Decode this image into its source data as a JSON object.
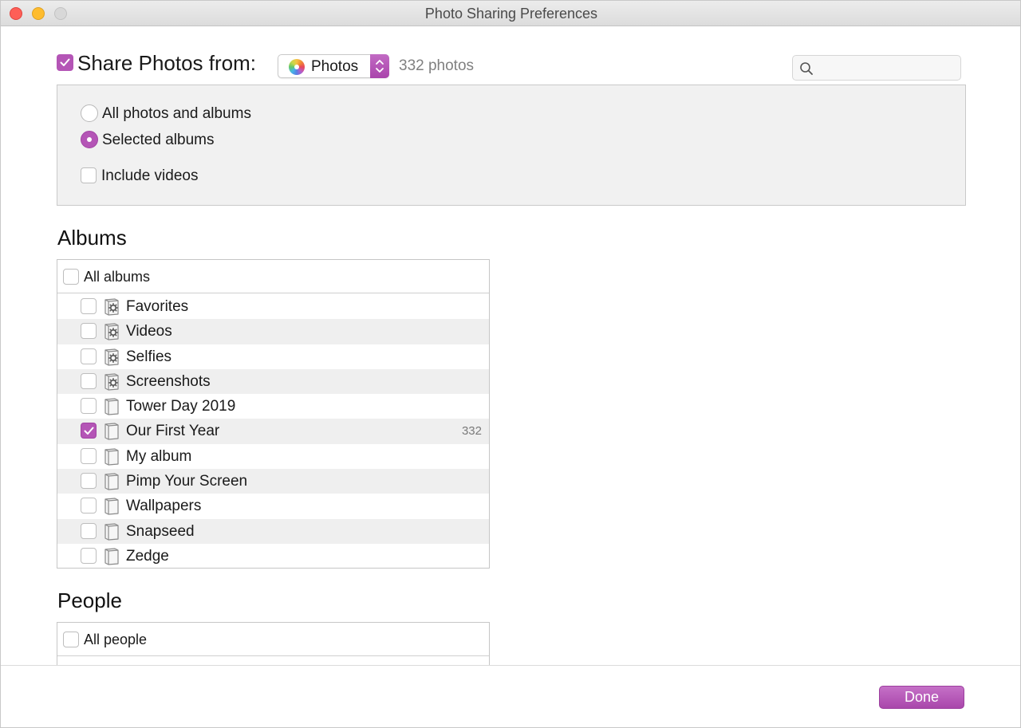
{
  "window": {
    "title": "Photo Sharing Preferences"
  },
  "header": {
    "share_label": "Share Photos from:",
    "share_checked": true,
    "source": {
      "label": "Photos",
      "icon": "photos-app-icon"
    },
    "photo_count": "332 photos",
    "search": {
      "placeholder": "",
      "value": ""
    }
  },
  "options": {
    "all_photos_label": "All photos and albums",
    "selected_albums_label": "Selected albums",
    "selected_option": "Selected albums",
    "include_videos_label": "Include videos",
    "include_videos_checked": false
  },
  "albums": {
    "title": "Albums",
    "all_label": "All albums",
    "items": [
      {
        "label": "Favorites",
        "icon": "smart-album-icon",
        "checked": false,
        "count": ""
      },
      {
        "label": "Videos",
        "icon": "smart-album-icon",
        "checked": false,
        "count": ""
      },
      {
        "label": "Selfies",
        "icon": "smart-album-icon",
        "checked": false,
        "count": ""
      },
      {
        "label": "Screenshots",
        "icon": "smart-album-icon",
        "checked": false,
        "count": ""
      },
      {
        "label": "Tower Day 2019",
        "icon": "album-icon",
        "checked": false,
        "count": ""
      },
      {
        "label": "Our First Year",
        "icon": "album-icon",
        "checked": true,
        "count": "332"
      },
      {
        "label": "My album",
        "icon": "album-icon",
        "checked": false,
        "count": ""
      },
      {
        "label": "Pimp Your Screen",
        "icon": "album-icon",
        "checked": false,
        "count": ""
      },
      {
        "label": "Wallpapers",
        "icon": "album-icon",
        "checked": false,
        "count": ""
      },
      {
        "label": "Snapseed",
        "icon": "album-icon",
        "checked": false,
        "count": ""
      },
      {
        "label": "Zedge",
        "icon": "album-icon",
        "checked": false,
        "count": ""
      }
    ]
  },
  "people": {
    "title": "People",
    "all_label": "All people"
  },
  "footer": {
    "done_label": "Done"
  },
  "colors": {
    "accent": "#b455b6",
    "stripe": "#efefef",
    "panel": "#f1f1f1"
  }
}
